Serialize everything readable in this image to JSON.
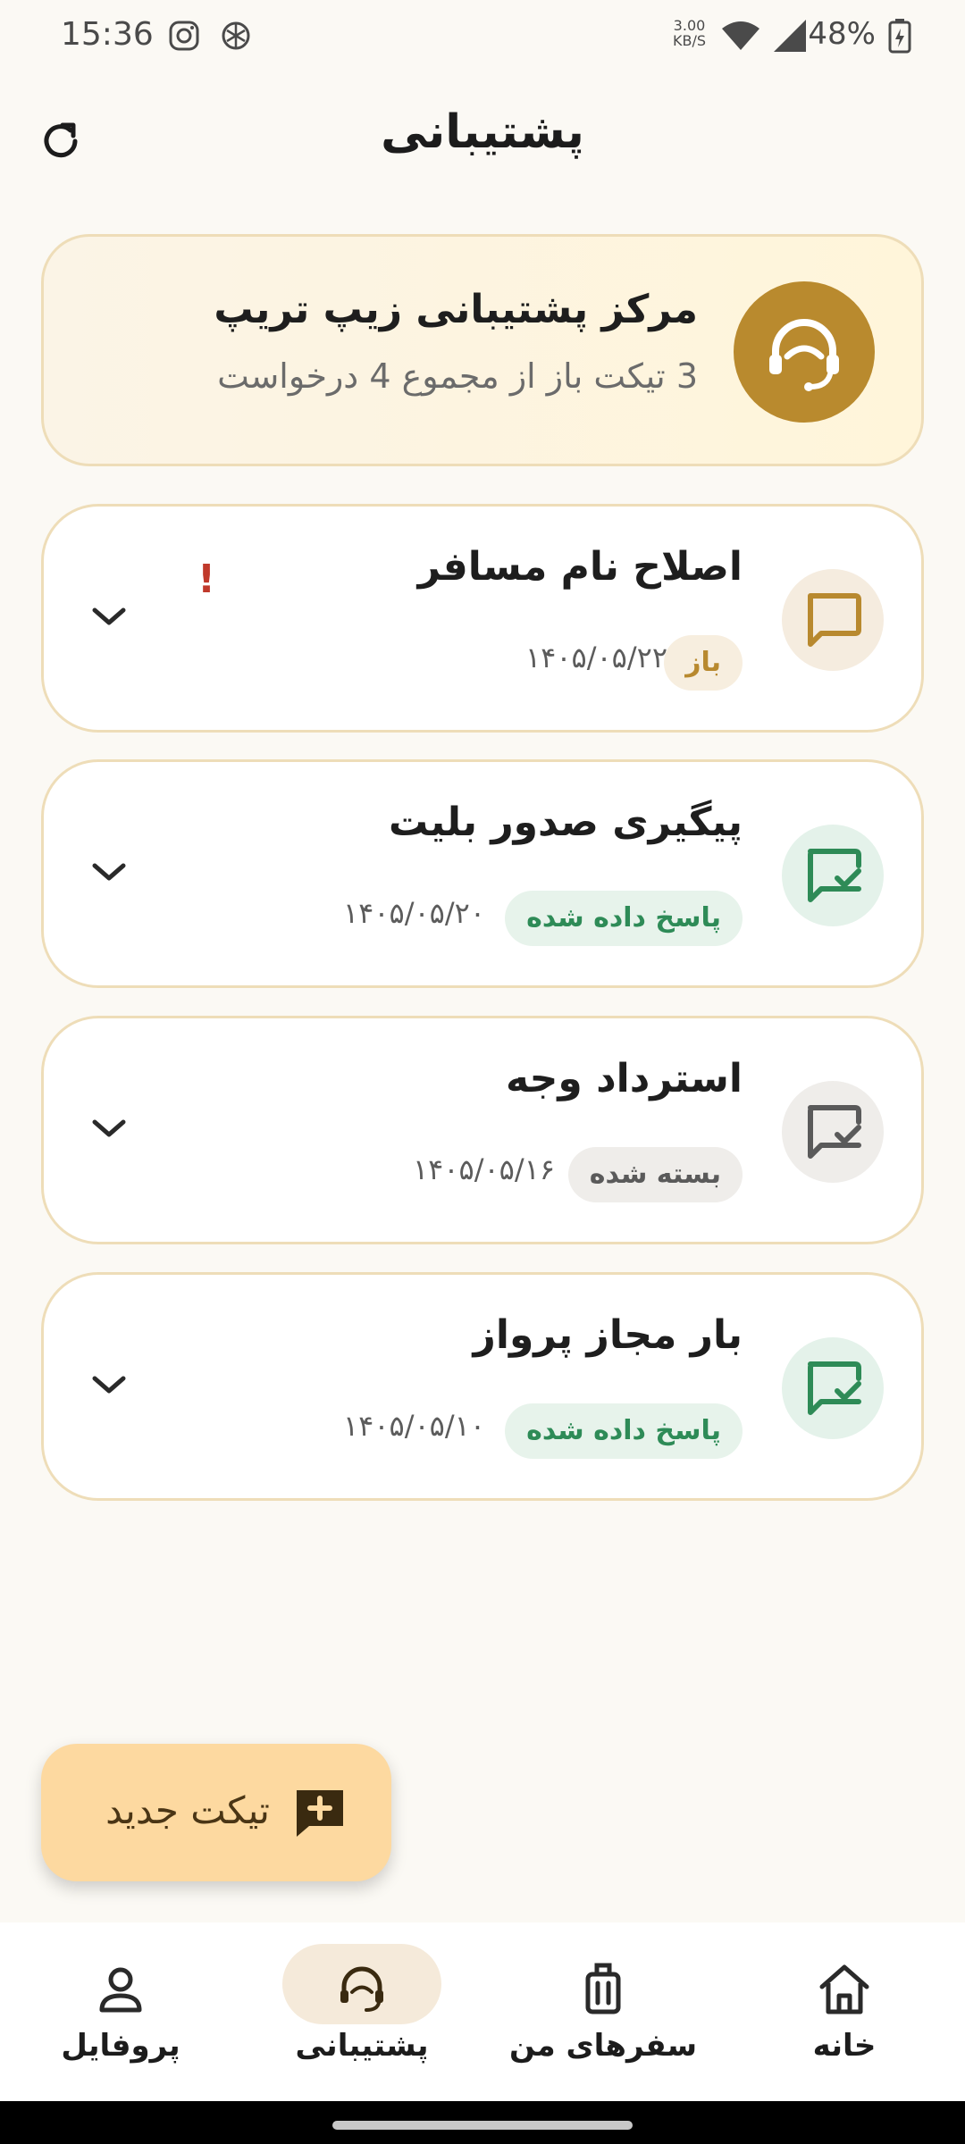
{
  "status_bar": {
    "time": "15:36",
    "speed_value": "3.00",
    "speed_unit": "KB/S",
    "battery_pct": "48%"
  },
  "header": {
    "title": "پشتیبانی"
  },
  "summary": {
    "title": "مرکز پشتیبانی زیپ تریپ",
    "subtitle": "3 تیکت باز از مجموع 4 درخواست"
  },
  "tickets": [
    {
      "title": "اصلاح نام مسافر",
      "status": "باز",
      "date": "۱۴۰۵/۰۵/۲۲",
      "alert": "!",
      "status_color": "#B8892F",
      "badge_bg": "#F7EEDF",
      "icon_bg": "#F5ECDF"
    },
    {
      "title": "پیگیری صدور بلیت",
      "status": "پاسخ داده شده",
      "date": "۱۴۰۵/۰۵/۲۰",
      "status_color": "#2E8B57",
      "badge_bg": "#E7F3EB",
      "icon_bg": "#E4F2EA"
    },
    {
      "title": "استرداد وجه",
      "status": "بسته شده",
      "date": "۱۴۰۵/۰۵/۱۶",
      "status_color": "#5A5A5A",
      "badge_bg": "#EFEDEA",
      "icon_bg": "#EFEDEA"
    },
    {
      "title": "بار مجاز پرواز",
      "status": "پاسخ داده شده",
      "date": "۱۴۰۵/۰۵/۱۰",
      "status_color": "#2E8B57",
      "badge_bg": "#E7F3EB",
      "icon_bg": "#E4F2EA"
    }
  ],
  "fab": {
    "label": "تیکت جدید"
  },
  "bottom_nav": [
    {
      "label": "پروفایل",
      "icon": "person-icon"
    },
    {
      "label": "پشتیبانی",
      "icon": "support-headset-icon",
      "active": true
    },
    {
      "label": "سفرهای من",
      "icon": "luggage-icon"
    },
    {
      "label": "خانه",
      "icon": "home-icon"
    }
  ],
  "colors": {
    "accent": "#B98A2E",
    "background": "#FBF9F4",
    "card_border": "#EEDDB8",
    "fab_bg": "#FDD9A0",
    "nav_active_pill": "#F5EADA"
  }
}
